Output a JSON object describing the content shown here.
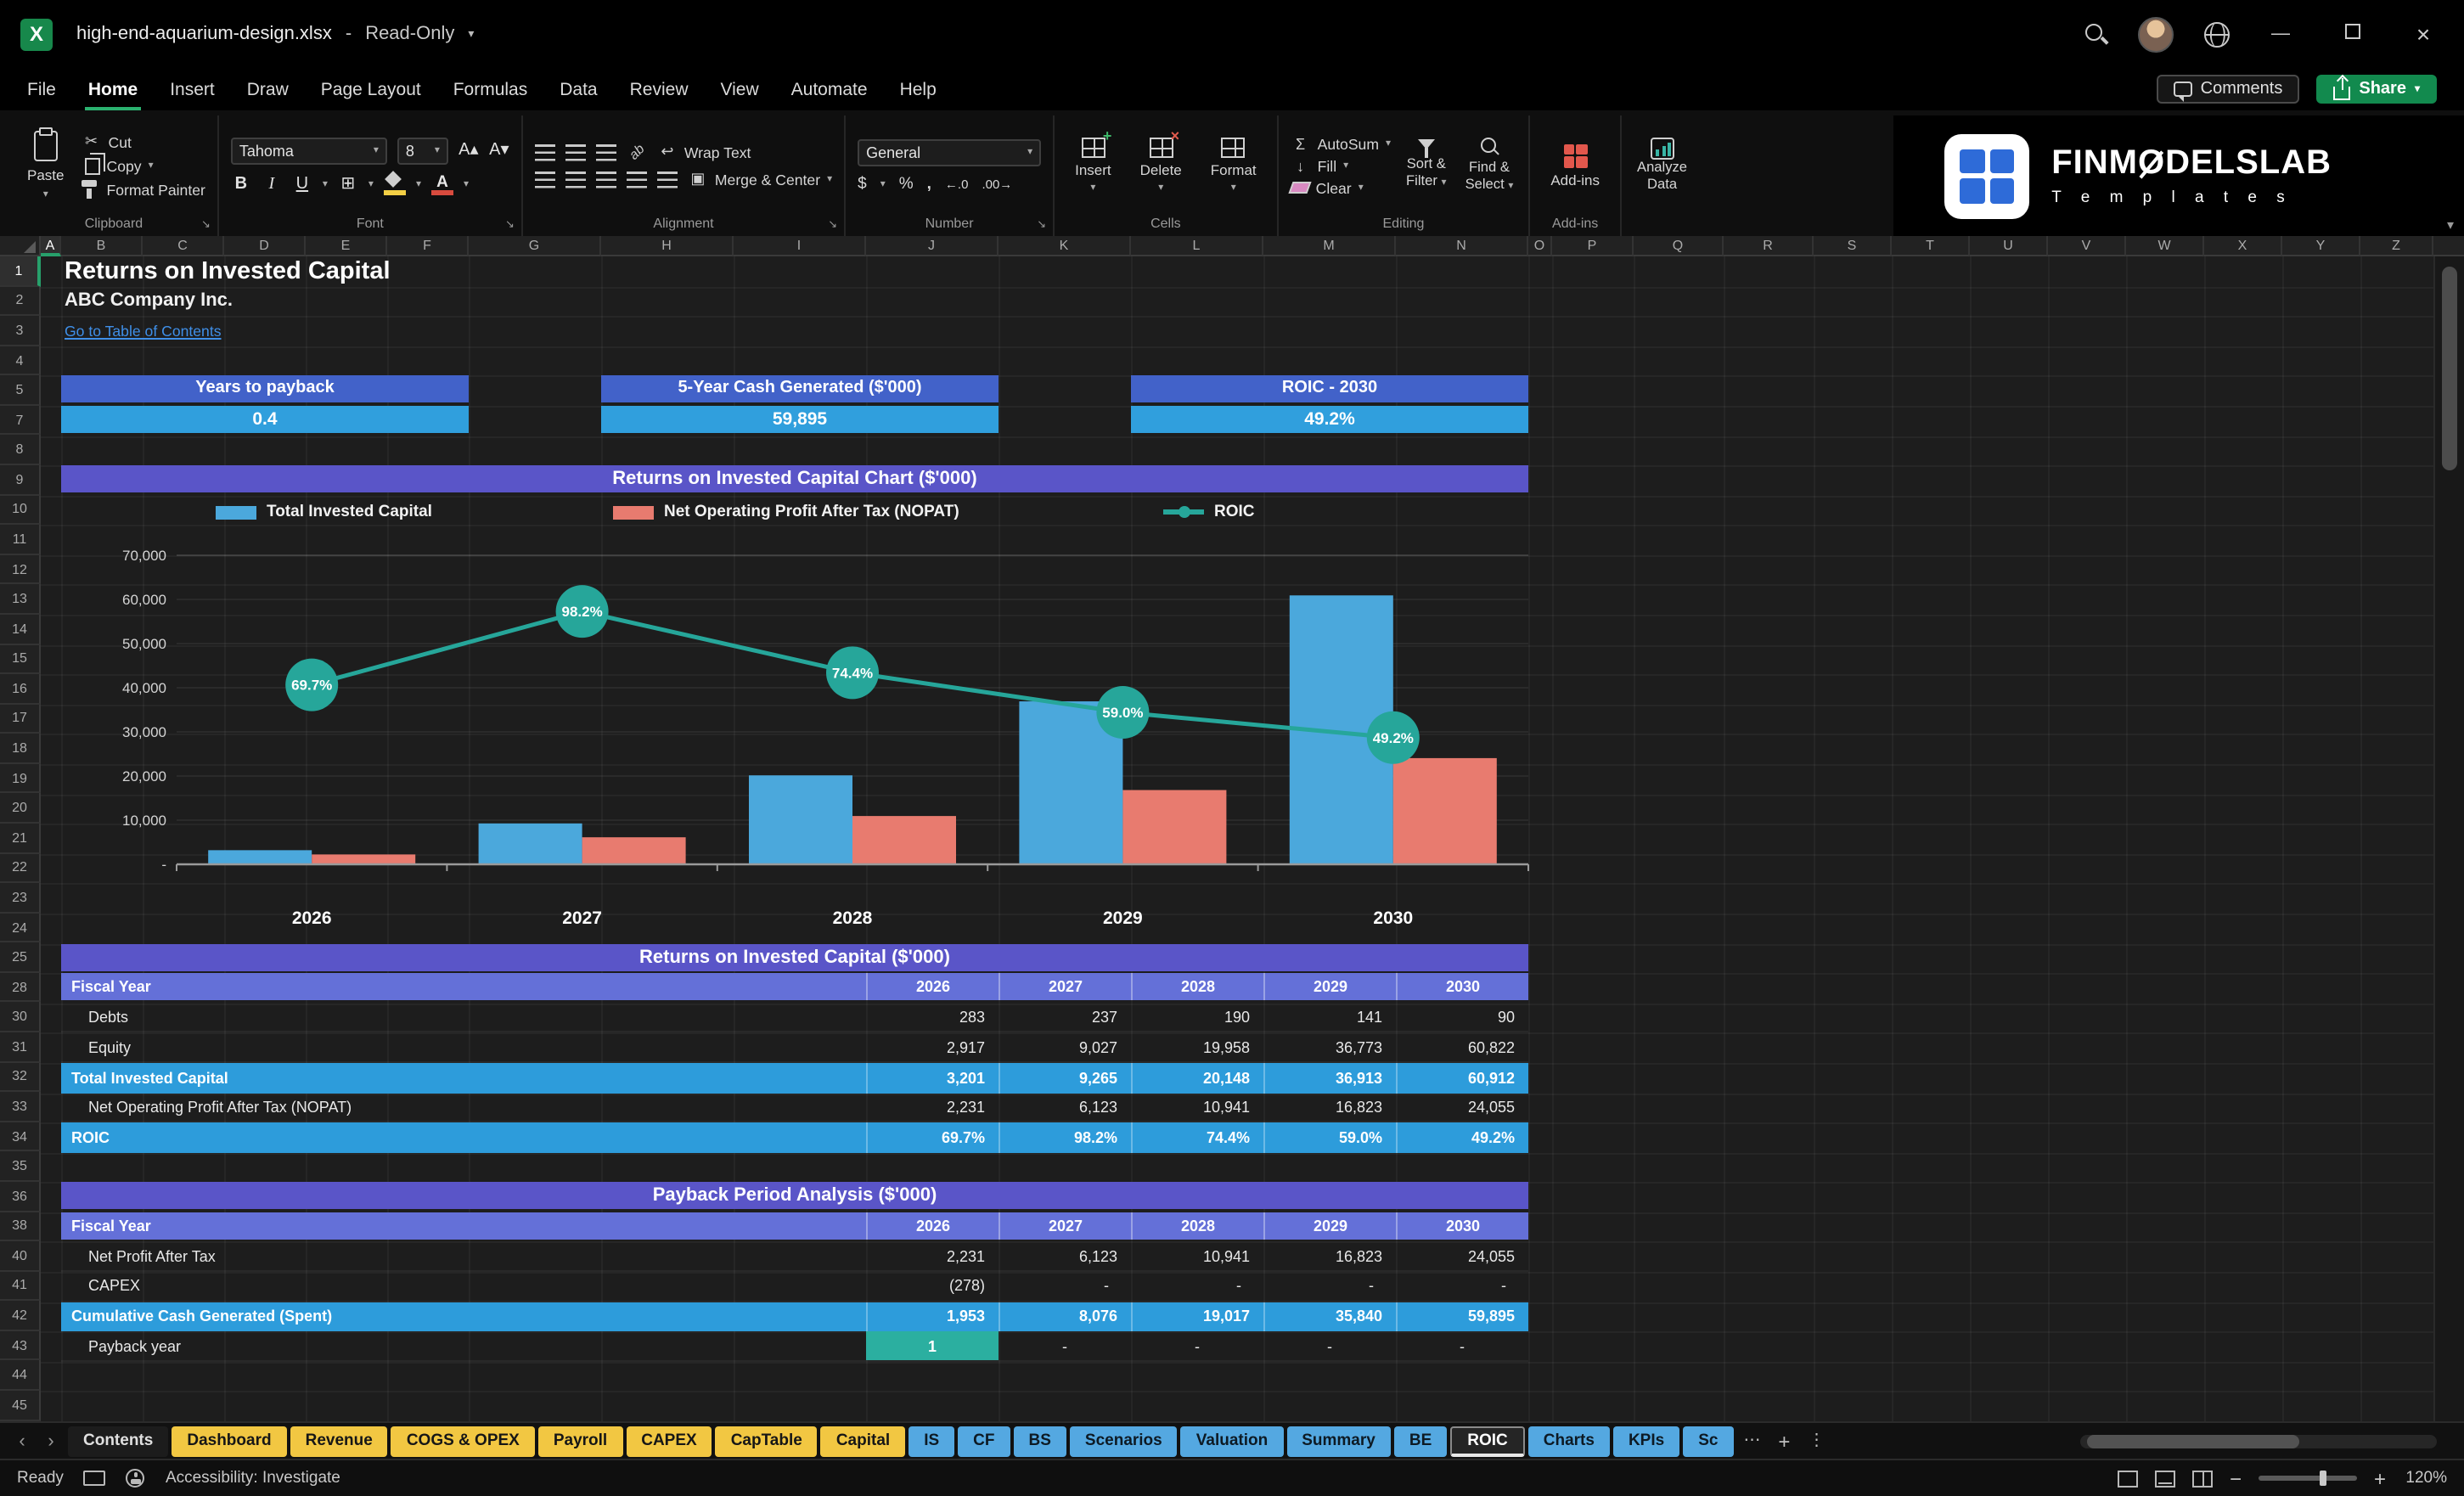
{
  "titlebar": {
    "filename": "high-end-aquarium-design.xlsx",
    "separator": "-",
    "mode": "Read-Only"
  },
  "menubar": {
    "items": [
      "File",
      "Home",
      "Insert",
      "Draw",
      "Page Layout",
      "Formulas",
      "Data",
      "Review",
      "View",
      "Automate",
      "Help"
    ],
    "active": "Home",
    "comments": "Comments",
    "share": "Share"
  },
  "ribbon": {
    "clipboard": {
      "paste": "Paste",
      "cut": "Cut",
      "copy": "Copy",
      "format_painter": "Format Painter",
      "group": "Clipboard"
    },
    "font": {
      "name": "Tahoma",
      "size": "8",
      "bold": "B",
      "italic": "I",
      "underline": "U",
      "group": "Font"
    },
    "alignment": {
      "wrap": "Wrap Text",
      "merge": "Merge & Center",
      "group": "Alignment"
    },
    "number": {
      "format": "General",
      "group": "Number"
    },
    "cells": {
      "insert": "Insert",
      "del": "Delete",
      "format": "Format",
      "group": "Cells"
    },
    "editing": {
      "autosum": "AutoSum",
      "fill": "Fill",
      "clear": "Clear",
      "sort1": "Sort &",
      "sort2": "Filter",
      "find1": "Find &",
      "find2": "Select",
      "group": "Editing"
    },
    "addins": {
      "label": "Add-ins",
      "group": "Add-ins"
    },
    "analyze": {
      "line1": "Analyze",
      "line2": "Data"
    },
    "brand": {
      "pre": "FINM",
      "o": "O",
      "post": "DELSLAB",
      "sub": "T e m p l a t e s"
    }
  },
  "glyphs": {
    "caret": "▾",
    "chl": "‹",
    "chr": "›",
    "dots_h": "⋯",
    "dots_v": "⋮",
    "plus": "+",
    "minus": "−",
    "close": "×",
    "minimize": "—",
    "scissors": "✂",
    "sigma": "Σ",
    "wrap": "↩",
    "merge": "▣",
    "borders": "⊞",
    "launcher": "↘",
    "dollar": "$",
    "percent": "%",
    "comma": ",",
    "dec_inc": "←.0",
    "dec_dec": ".00→",
    "fill_down": "↓",
    "orient": "ab",
    "inc_a": "A▴",
    "dec_a": "A▾",
    "excel_x": "X"
  },
  "sheet": {
    "title": "Returns on Invested Capital",
    "company": "ABC Company Inc.",
    "link": "Go to Table of Contents",
    "kpis": [
      {
        "label": "Years to payback",
        "value": "0.4"
      },
      {
        "label": "5-Year Cash Generated ($'000)",
        "value": "59,895"
      },
      {
        "label": "ROIC - 2030",
        "value": "49.2%"
      }
    ]
  },
  "chart_data": {
    "type": "combo",
    "title": "Returns on Invested Capital Chart ($'000)",
    "categories": [
      "2026",
      "2027",
      "2028",
      "2029",
      "2030"
    ],
    "series": [
      {
        "name": "Total Invested Capital",
        "type": "bar",
        "color": "#4BA8DC",
        "values": [
          3201,
          9265,
          20148,
          36913,
          60912
        ]
      },
      {
        "name": "Net Operating Profit After Tax (NOPAT)",
        "type": "bar",
        "color": "#E87B6F",
        "values": [
          2231,
          6123,
          10941,
          16823,
          24055
        ]
      },
      {
        "name": "ROIC",
        "type": "line",
        "color": "#26A69A",
        "values_pct": [
          69.7,
          98.2,
          74.4,
          59.0,
          49.2
        ],
        "labels": [
          "69.7%",
          "98.2%",
          "74.4%",
          "59.0%",
          "49.2%"
        ]
      }
    ],
    "y_axis": {
      "max": 70000,
      "ticks": [
        "70,000",
        "60,000",
        "50,000",
        "40,000",
        "30,000",
        "20,000",
        "10,000",
        "-"
      ]
    },
    "secondary_axis": {
      "max_pct": 120
    },
    "legend_position": "top",
    "grid": "minimal"
  },
  "table1": {
    "title": "Returns on Invested Capital ($'000)",
    "fiscal_label": "Fiscal Year",
    "years": [
      "2026",
      "2027",
      "2028",
      "2029",
      "2030"
    ],
    "rows": [
      {
        "label": "Debts",
        "style": "normal",
        "values": [
          "283",
          "237",
          "190",
          "141",
          "90"
        ]
      },
      {
        "label": "Equity",
        "style": "normal",
        "values": [
          "2,917",
          "9,027",
          "19,958",
          "36,773",
          "60,822"
        ]
      },
      {
        "label": "Total Invested Capital",
        "style": "highlight",
        "values": [
          "3,201",
          "9,265",
          "20,148",
          "36,913",
          "60,912"
        ]
      },
      {
        "label": "Net Operating Profit After Tax (NOPAT)",
        "style": "normal",
        "values": [
          "2,231",
          "6,123",
          "10,941",
          "16,823",
          "24,055"
        ]
      },
      {
        "label": "ROIC",
        "style": "highlight",
        "values": [
          "69.7%",
          "98.2%",
          "74.4%",
          "59.0%",
          "49.2%"
        ]
      }
    ]
  },
  "table2": {
    "title": "Payback Period Analysis ($'000)",
    "fiscal_label": "Fiscal Year",
    "years": [
      "2026",
      "2027",
      "2028",
      "2029",
      "2030"
    ],
    "rows": [
      {
        "label": "Net Profit After Tax",
        "style": "normal",
        "values": [
          "2,231",
          "6,123",
          "10,941",
          "16,823",
          "24,055"
        ]
      },
      {
        "label": "CAPEX",
        "style": "normal",
        "values": [
          "(278)",
          "-",
          "-",
          "-",
          "-"
        ]
      },
      {
        "label": "Cumulative Cash Generated (Spent)",
        "style": "highlight",
        "values": [
          "1,953",
          "8,076",
          "19,017",
          "35,840",
          "59,895"
        ]
      },
      {
        "label": "Payback year",
        "style": "normal",
        "align": "center",
        "cell_highlight": [
          0
        ],
        "values": [
          "1",
          "-",
          "-",
          "-",
          "-"
        ]
      }
    ]
  },
  "grid": {
    "columns": [
      "A",
      "B",
      "C",
      "D",
      "E",
      "F",
      "G",
      "H",
      "I",
      "J",
      "K",
      "L",
      "M",
      "N",
      "O",
      "P",
      "Q",
      "R",
      "S",
      "T",
      "U",
      "V",
      "W",
      "X",
      "Y",
      "Z"
    ],
    "rows": [
      "1",
      "2",
      "3",
      "4",
      "5",
      "7",
      "8",
      "9",
      "10",
      "11",
      "12",
      "13",
      "14",
      "15",
      "16",
      "17",
      "18",
      "19",
      "20",
      "21",
      "22",
      "23",
      "24",
      "25",
      "28",
      "30",
      "31",
      "32",
      "33",
      "34",
      "35",
      "36",
      "38",
      "40",
      "41",
      "42",
      "43",
      "44",
      "45"
    ],
    "selection": {
      "col": "A",
      "row": "1"
    }
  },
  "tabs": {
    "active": "ROIC",
    "sheets": [
      {
        "label": "Contents",
        "type": "plain"
      },
      {
        "label": "Dashboard",
        "type": "yellow"
      },
      {
        "label": "Revenue",
        "type": "yellow"
      },
      {
        "label": "COGS & OPEX",
        "type": "yellow"
      },
      {
        "label": "Payroll",
        "type": "yellow"
      },
      {
        "label": "CAPEX",
        "type": "yellow"
      },
      {
        "label": "CapTable",
        "type": "yellow"
      },
      {
        "label": "Capital",
        "type": "yellow"
      },
      {
        "label": "IS",
        "type": "blue"
      },
      {
        "label": "CF",
        "type": "blue"
      },
      {
        "label": "BS",
        "type": "blue"
      },
      {
        "label": "Scenarios",
        "type": "blue"
      },
      {
        "label": "Valuation",
        "type": "blue"
      },
      {
        "label": "Summary",
        "type": "blue"
      },
      {
        "label": "BE",
        "type": "blue"
      },
      {
        "label": "ROIC",
        "type": "active"
      },
      {
        "label": "Charts",
        "type": "blue"
      },
      {
        "label": "KPIs",
        "type": "blue"
      },
      {
        "label": "Sc",
        "type": "blue"
      }
    ]
  },
  "statusbar": {
    "ready": "Ready",
    "accessibility": "Accessibility: Investigate",
    "zoom": "120%"
  },
  "colors": {
    "kpi_header": "#4262C9",
    "kpi_value": "#309FDD",
    "section_header": "#5A55C8",
    "fiscal_row": "#6470D8",
    "highlight_row": "#2D9CDB",
    "payback_cell": "#2BAFA0",
    "bar_blue": "#4BA8DC",
    "bar_salmon": "#E87B6F",
    "line_teal": "#26A69A",
    "tab_yellow": "#F2C742",
    "tab_blue": "#54A8E1",
    "share_green": "#128A4E",
    "link_blue": "#3F8FE8"
  }
}
